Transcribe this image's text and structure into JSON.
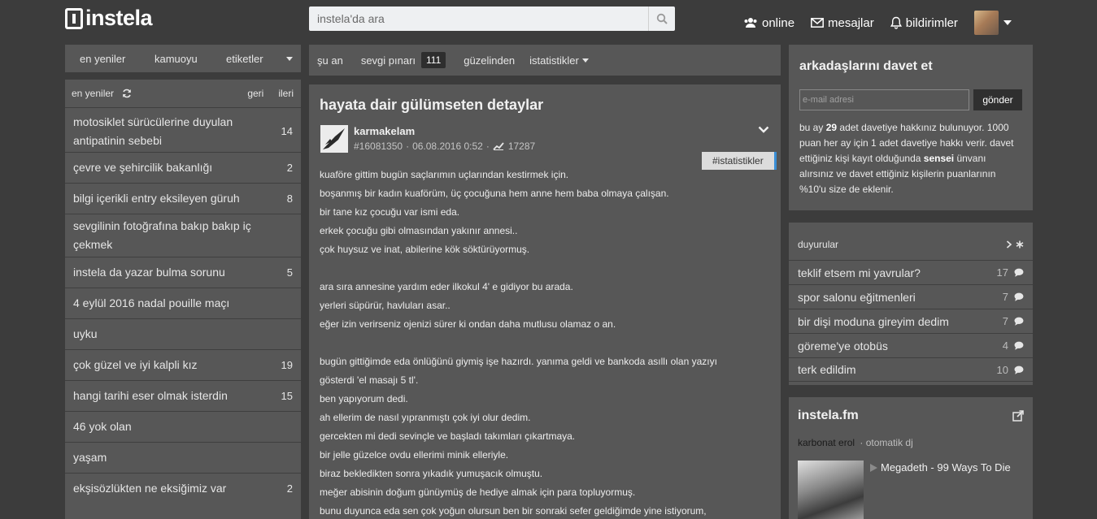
{
  "header": {
    "logo": "instela",
    "search_placeholder": "instela'da ara",
    "nav": {
      "online": "online",
      "messages": "mesajlar",
      "notifications": "bildirimler"
    }
  },
  "left_tabs": [
    "en yeniler",
    "kamuoyu",
    "etiketler"
  ],
  "left_list": {
    "title": "en yeniler",
    "back": "geri",
    "next": "ileri",
    "items": [
      {
        "title": "motosiklet sürücülerine duyulan antipatinin sebebi",
        "count": "14"
      },
      {
        "title": "çevre ve şehircilik bakanlığı",
        "count": "2"
      },
      {
        "title": "bilgi içerikli entry eksileyen güruh",
        "count": "8"
      },
      {
        "title": "sevgilinin fotoğrafına bakıp bakıp iç çekmek",
        "count": ""
      },
      {
        "title": "instela da yazar bulma sorunu",
        "count": "5"
      },
      {
        "title": "4 eylül 2016 nadal pouille maçı",
        "count": ""
      },
      {
        "title": "uyku",
        "count": ""
      },
      {
        "title": "çok güzel ve iyi kalpli kız",
        "count": "19"
      },
      {
        "title": "hangi tarihi eser olmak isterdin",
        "count": "15"
      },
      {
        "title": "46 yok olan",
        "count": ""
      },
      {
        "title": "yaşam",
        "count": ""
      },
      {
        "title": "ekşisözlükten ne eksiğimiz var",
        "count": "2"
      }
    ]
  },
  "mid_tabs": {
    "now": "şu an",
    "love": "sevgi pınarı",
    "love_count": "111",
    "best": "güzelinden",
    "stats": "istatistikler"
  },
  "entry": {
    "title": "hayata dair gülümseten detaylar",
    "author": "karmakelam",
    "id": "#16081350",
    "date": "06.08.2016 0:52",
    "views": "17287",
    "hashtag": "#istatistikler",
    "lines": [
      "kuaföre gittim bugün saçlarımın uçlarından kestirmek için.",
      "boşanmış bir kadın kuaförüm, üç çocuğuna hem anne hem baba olmaya çalışan.",
      "bir tane kız çocuğu var ismi eda.",
      "erkek çocuğu gibi olmasından yakınır annesi..",
      "çok huysuz ve inat, abilerine kök söktürüyormuş.",
      "",
      "ara sıra annesine yardım eder ilkokul 4' e gidiyor bu arada.",
      "yerleri süpürür, havluları asar..",
      "eğer izin verirseniz ojenizi sürer ki ondan daha mutlusu olamaz o an.",
      "",
      "bugün gittiğimde eda önlüğünü giymiş işe hazırdı. yanıma geldi ve bankoda asıllı olan yazıyı",
      "gösterdi 'el masajı 5 tl'.",
      "ben yapıyorum dedi.",
      "ah ellerim de nasıl yıpranmıştı çok iyi olur dedim.",
      "gercekten mi dedi sevinçle ve başladı takımları çıkartmaya.",
      "bir jelle güzelce ovdu ellerimi minik elleriyle.",
      "biraz bekledikten sonra yıkadık yumuşacık olmuştu.",
      "meğer abisinin doğum günüymüş de hediye almak için para topluyormuş.",
      "bunu duyunca eda sen çok yoğun olursun ben bir sonraki sefer geldiğimde yine istiyorum,"
    ]
  },
  "invite": {
    "title": "arkadaşlarını davet et",
    "email_placeholder": "e-mail adresi",
    "send": "gönder",
    "text_1": "bu ay ",
    "count": "29",
    "text_2": " adet davetiye hakkınız bulunuyor. 1000 puan her ay için 1 adet davetiye hakkı verir. davet ettiğiniz kişi kayıt olduğunda ",
    "sensei": "sensei",
    "text_3": " ünvanı alırsınız ve davet ettiğiniz kişilerin puanlarının %10'u size de eklenir."
  },
  "news": {
    "title": "duyurular",
    "items": [
      {
        "title": "teklif etsem mi yavrular?",
        "count": "17"
      },
      {
        "title": "spor salonu eğitmenleri",
        "count": "7"
      },
      {
        "title": "bir dişi moduna gireyim dedim",
        "count": "7"
      },
      {
        "title": "göreme'ye otobüs",
        "count": "4"
      },
      {
        "title": "terk edildim",
        "count": "10"
      }
    ]
  },
  "fm": {
    "title": "instela.fm",
    "dj_name": "karbonat erol",
    "dj_type": "otomatik dj",
    "track": "Megadeth - 99 Ways To Die"
  }
}
